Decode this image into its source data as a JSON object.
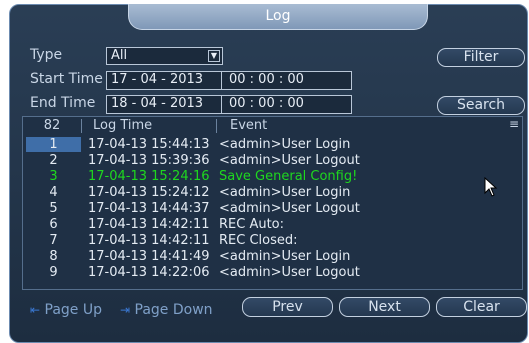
{
  "window": {
    "title": "Log"
  },
  "filters": {
    "type_label": "Type",
    "type_value": "All",
    "start_label": "Start Time",
    "start_date": "17 - 04 - 2013",
    "start_time": "00 : 00 : 00",
    "end_label": "End Time",
    "end_date": "18 - 04 - 2013",
    "end_time": "00 : 00 : 00",
    "filter_button": "Filter",
    "search_button": "Search"
  },
  "list": {
    "count": "82",
    "col_time": "Log Time",
    "col_event": "Event",
    "rows": [
      {
        "num": "1",
        "time": "17-04-13 15:44:13",
        "event": "<admin>User Login"
      },
      {
        "num": "2",
        "time": "17-04-13 15:39:36",
        "event": "<admin>User Logout"
      },
      {
        "num": "3",
        "time": "17-04-13 15:24:16",
        "event": "Save General Config!"
      },
      {
        "num": "4",
        "time": "17-04-13 15:24:12",
        "event": "<admin>User Login"
      },
      {
        "num": "5",
        "time": "17-04-13 14:44:37",
        "event": "<admin>User Logout"
      },
      {
        "num": "6",
        "time": "17-04-13 14:42:11",
        "event": "REC Auto:"
      },
      {
        "num": "7",
        "time": "17-04-13 14:42:11",
        "event": "REC Closed:"
      },
      {
        "num": "8",
        "time": "17-04-13 14:41:49",
        "event": "<admin>User Login"
      },
      {
        "num": "9",
        "time": "17-04-13 14:22:06",
        "event": "<admin>User Logout"
      }
    ],
    "highlight_color": "#1fd81f",
    "selected_color": "#3f6ea8"
  },
  "footer": {
    "page_up": "Page Up",
    "page_down": "Page Down",
    "prev": "Prev",
    "next": "Next",
    "clear": "Clear"
  }
}
